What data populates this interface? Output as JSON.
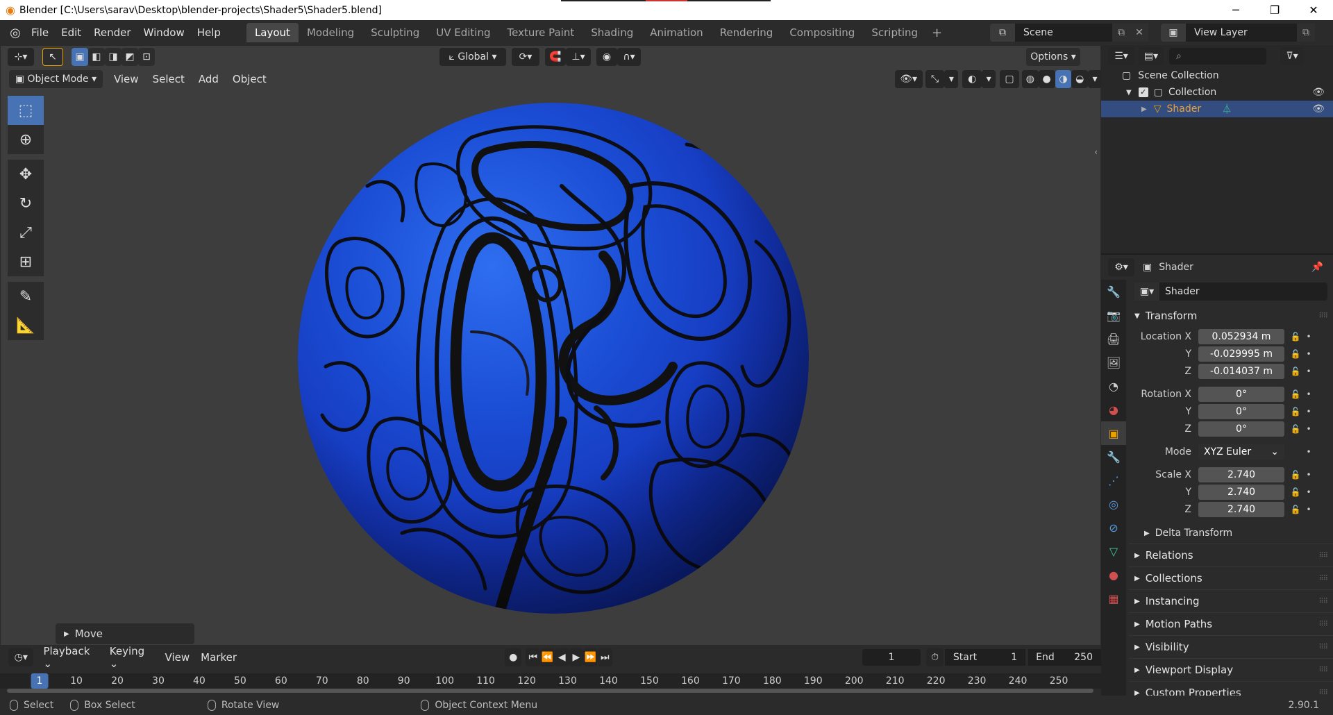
{
  "window": {
    "title": "Blender [C:\\Users\\sarav\\Desktop\\blender-projects\\Shader5\\Shader5.blend]",
    "minimize": "─",
    "maximize": "❐",
    "close": "✕"
  },
  "menubar": {
    "items": [
      "File",
      "Edit",
      "Render",
      "Window",
      "Help"
    ],
    "workspaces": [
      "Layout",
      "Modeling",
      "Sculpting",
      "UV Editing",
      "Texture Paint",
      "Shading",
      "Animation",
      "Rendering",
      "Compositing",
      "Scripting"
    ],
    "active_workspace": "Layout",
    "add_workspace": "+",
    "scene": "Scene",
    "view_layer": "View Layer"
  },
  "viewport": {
    "orientation": "Global",
    "options": "Options",
    "mode": "Object Mode",
    "menus": [
      "View",
      "Select",
      "Add",
      "Object"
    ],
    "last_op": "Move",
    "sphere_color": "#1b4fd6"
  },
  "timeline": {
    "menus": [
      "Playback",
      "Keying",
      "View",
      "Marker"
    ],
    "current_frame": "1",
    "start_label": "Start",
    "start": "1",
    "end_label": "End",
    "end": "250",
    "ticks": [
      "1",
      "10",
      "20",
      "30",
      "40",
      "50",
      "60",
      "70",
      "80",
      "90",
      "100",
      "110",
      "120",
      "130",
      "140",
      "150",
      "160",
      "170",
      "180",
      "190",
      "200",
      "210",
      "220",
      "230",
      "240",
      "250"
    ]
  },
  "statusbar": {
    "select": "Select",
    "box_select": "Box Select",
    "rotate_view": "Rotate View",
    "context_menu": "Object Context Menu",
    "version": "2.90.1"
  },
  "outliner": {
    "scene_collection": "Scene Collection",
    "collection": "Collection",
    "object": "Shader"
  },
  "properties": {
    "object_name": "Shader",
    "data_name": "Shader",
    "transform_label": "Transform",
    "location": {
      "label": "Location X",
      "x": "0.052934 m",
      "y": "-0.029995 m",
      "z": "-0.014037 m"
    },
    "rotation": {
      "label": "Rotation X",
      "x": "0°",
      "y": "0°",
      "z": "0°"
    },
    "mode_label": "Mode",
    "mode": "XYZ Euler",
    "scale": {
      "label": "Scale X",
      "x": "2.740",
      "y": "2.740",
      "z": "2.740"
    },
    "axis_y": "Y",
    "axis_z": "Z",
    "delta_transform": "Delta Transform",
    "panels": [
      "Relations",
      "Collections",
      "Instancing",
      "Motion Paths",
      "Visibility",
      "Viewport Display",
      "Custom Properties"
    ]
  }
}
